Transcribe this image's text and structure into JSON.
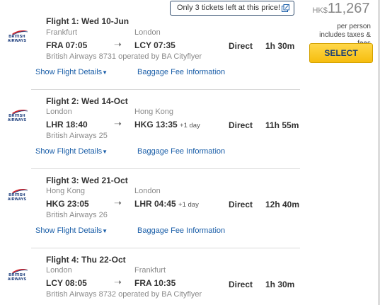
{
  "tickets_notice": "Only 3 tickets left at this price!",
  "price": {
    "currency": "HK$",
    "amount": "11,267",
    "per_person": "per person",
    "includes": "includes taxes & fees",
    "select_label": "SELECT"
  },
  "airline_logo_text": [
    "BRITISH",
    "AIRWAYS"
  ],
  "colors": {
    "link": "#1a5ea8",
    "select_button": "#f6bd0e",
    "logo_blue": "#0b2f73",
    "logo_red": "#d2232a"
  },
  "flights": [
    {
      "title": "Flight 1:  Wed 10-Jun",
      "from_city": "Frankfurt",
      "to_city": "London",
      "dep": "FRA  07:05",
      "arr": "LCY  07:35",
      "arr_note": "",
      "stops": "Direct",
      "duration": "1h 30m",
      "operator": "British Airways 8731 operated by BA Cityflyer",
      "details_link": "Show Flight Details",
      "baggage_link": "Baggage Fee Information"
    },
    {
      "title": "Flight 2:  Wed 14-Oct",
      "from_city": "London",
      "to_city": "Hong Kong",
      "dep": "LHR  18:40",
      "arr": "HKG  13:35",
      "arr_note": "+1 day",
      "stops": "Direct",
      "duration": "11h 55m",
      "operator": "British Airways 25",
      "details_link": "Show Flight Details",
      "baggage_link": "Baggage Fee Information"
    },
    {
      "title": "Flight 3:  Wed 21-Oct",
      "from_city": "Hong Kong",
      "to_city": "London",
      "dep": "HKG  23:05",
      "arr": "LHR  04:45",
      "arr_note": "+1 day",
      "stops": "Direct",
      "duration": "12h 40m",
      "operator": "British Airways 26",
      "details_link": "Show Flight Details",
      "baggage_link": "Baggage Fee Information"
    },
    {
      "title": "Flight 4:  Thu 22-Oct",
      "from_city": "London",
      "to_city": "Frankfurt",
      "dep": "LCY  08:05",
      "arr": "FRA  10:35",
      "arr_note": "",
      "stops": "Direct",
      "duration": "1h 30m",
      "operator": "British Airways 8732 operated by BA Cityflyer",
      "details_link": "",
      "baggage_link": ""
    }
  ]
}
